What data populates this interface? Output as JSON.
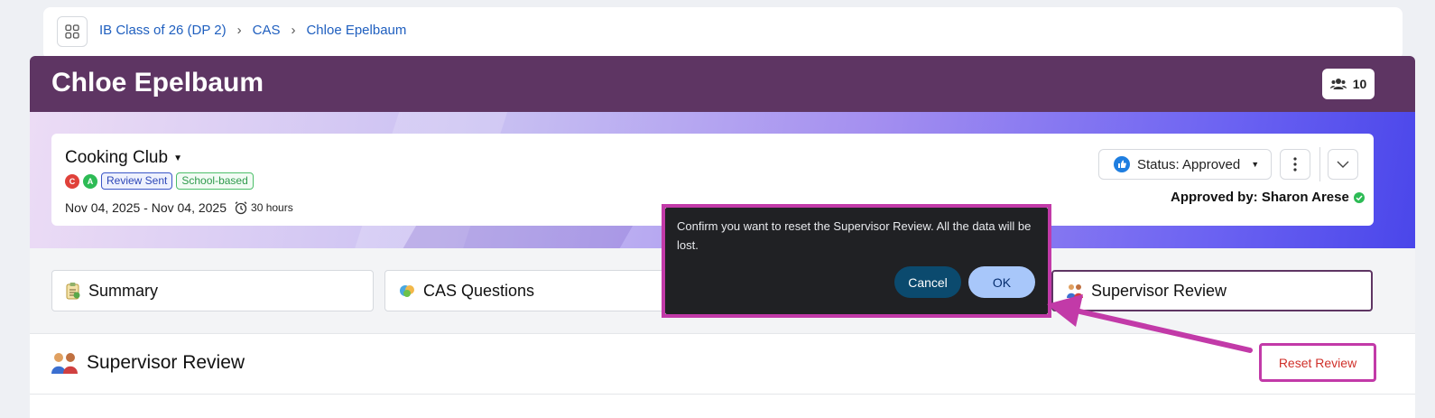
{
  "breadcrumb": [
    "IB Class of 26 (DP 2)",
    "CAS",
    "Chloe Epelbaum"
  ],
  "student_name": "Chloe Epelbaum",
  "members_count": "10",
  "activity": {
    "title": "Cooking Club",
    "badge_c": "C",
    "badge_a": "A",
    "tag_review": "Review Sent",
    "tag_school": "School-based",
    "dates": "Nov 04, 2025 - Nov 04, 2025",
    "hours": "30 hours",
    "status": "Status: Approved",
    "approved_by": "Approved by: Sharon Arese"
  },
  "tabs": [
    {
      "label": "Summary",
      "icon": "clipboard-icon"
    },
    {
      "label": "CAS Questions",
      "icon": "questions-icon"
    },
    {
      "label": "Supervisor Review",
      "icon": "people-icon"
    }
  ],
  "section": {
    "title": "Supervisor Review",
    "reset_label": "Reset Review"
  },
  "dialog": {
    "message": "Confirm you want to reset the Supervisor Review. All the data will be lost.",
    "cancel": "Cancel",
    "ok": "OK"
  },
  "colors": {
    "header": "#5e3563",
    "highlight": "#c23aa8",
    "dialog_bg": "#202124",
    "ok_button": "#a8c7fa",
    "cancel_button": "#0b4a6e"
  }
}
